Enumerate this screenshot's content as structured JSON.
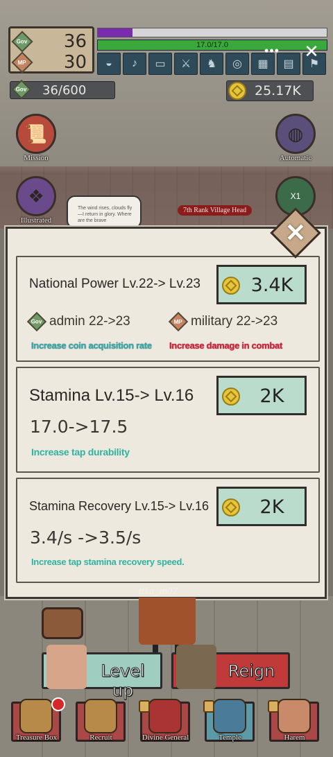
{
  "hud": {
    "gov_label": "Gov",
    "gov_value": "36",
    "mp_label": "MP",
    "mp_value": "30",
    "exp_fraction": 0.15,
    "stamina_text": "17.0/17.0",
    "stamina_fraction": 1.0,
    "gov_counter": "36/600",
    "coins": "25.17K",
    "more_icon": "more-icon",
    "close_icon": "close-icon"
  },
  "side_buttons": {
    "mission": "Mission",
    "automatic": "Automatic",
    "illustrated": "Illustrated",
    "boost_badge": "X1"
  },
  "scene": {
    "speech": "The wind rises, clouds fly—I return in glory. Where are the brave",
    "rank": "7th Rank Village Head"
  },
  "modal": {
    "cards": [
      {
        "title": "National Power Lv.22-> Lv.23",
        "price": "3.4K",
        "admin_label": "Gov",
        "admin_text": "admin 22->23",
        "military_label": "MP",
        "military_text": "military 22->23",
        "desc_left": "Increase coin acquisition rate",
        "desc_right": "Increase damage in combat"
      },
      {
        "title": "Stamina Lv.15-> Lv.16",
        "price": "2K",
        "change": "17.0->17.5",
        "desc": "Increase tap durability"
      },
      {
        "title": "Stamina Recovery Lv.15-> Lv.16",
        "price": "2K",
        "change": "3.4/s ->3.5/s",
        "desc": "Increase tap stamina recovery speed."
      }
    ]
  },
  "watermark": "itka_m07",
  "actions": {
    "level_up": "Level up",
    "reign": "Reign"
  },
  "nav": [
    "Treasure Box",
    "Recruit",
    "Divine General",
    "Temple",
    "Harem"
  ],
  "colors": {
    "price_button": "#b9dccd",
    "desc_green": "#2fb3a0",
    "desc_red": "#d3213b",
    "exp_bar": "#7a2bb0",
    "stamina_bar": "#3aa83a"
  }
}
